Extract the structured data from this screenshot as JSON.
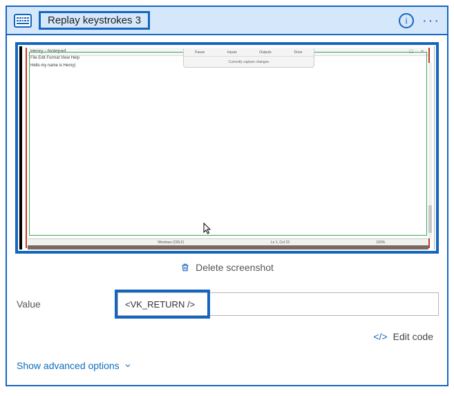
{
  "colors": {
    "accent": "#1565c0",
    "headerBg": "#d4e7fb",
    "link": "#0f6cbd"
  },
  "header": {
    "title": "Replay keystrokes 3"
  },
  "screenshot": {
    "windowTitle": "Henry - Notepad",
    "menubar": "File  Edit  Format  View  Help",
    "textContent": "Hello my name is Henry|",
    "toolbarTabs": [
      "Pause",
      "Inputs",
      "Outputs",
      "Done"
    ],
    "toolbarSub": "Currently capture changes",
    "statusItems": [
      "",
      "Windows (CRLF)",
      "Ln 1, Col 23",
      "100%"
    ]
  },
  "actions": {
    "deleteLabel": "Delete screenshot",
    "editCodeLabel": "Edit code",
    "advancedLabel": "Show advanced options"
  },
  "form": {
    "valueLabel": "Value",
    "value": "<VK_RETURN />"
  }
}
